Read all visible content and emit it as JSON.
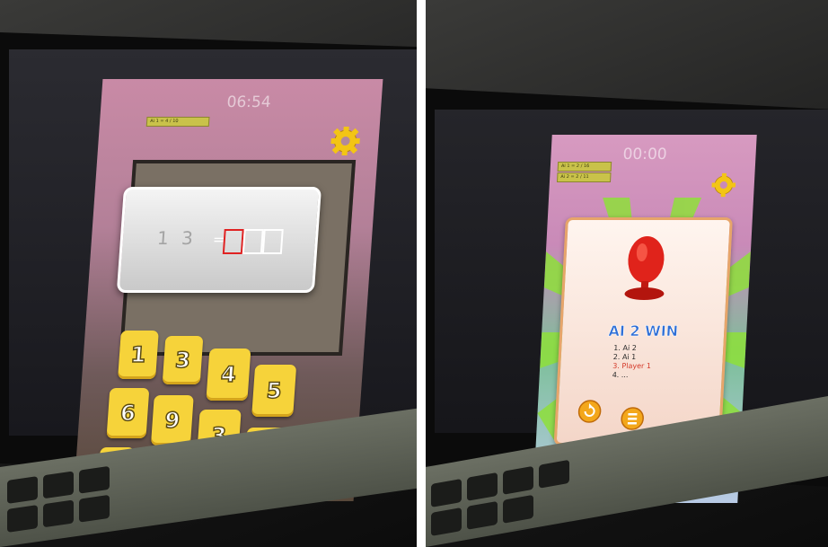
{
  "left_photo": {
    "game": {
      "timer": "06:54",
      "score_tag": "Ai 1 = 4 / 10",
      "question_text": "1 3",
      "answer_slots": 3,
      "tiles": [
        "1",
        "3",
        "4",
        "5",
        "6",
        "9",
        "3",
        "1"
      ]
    }
  },
  "right_photo": {
    "game": {
      "timer": "00:00",
      "score_tags": [
        "Ai 1 = 2 / 16",
        "Ai 2 = 2 / 11"
      ],
      "result_title": "AI 2 WIN",
      "ranking": [
        "1. Ai 2",
        "2. Ai 1",
        "3. Player 1",
        "4. ..."
      ]
    }
  },
  "colors": {
    "tile_yellow": "#f6d33a",
    "gear_yellow": "#f3c515",
    "game_pink": "#c98ab0",
    "trophy_red": "#e0231b",
    "win_title_blue": "#2f6fd6"
  },
  "icons": [
    "gear-icon",
    "trophy-icon",
    "replay-icon",
    "menu-icon"
  ]
}
